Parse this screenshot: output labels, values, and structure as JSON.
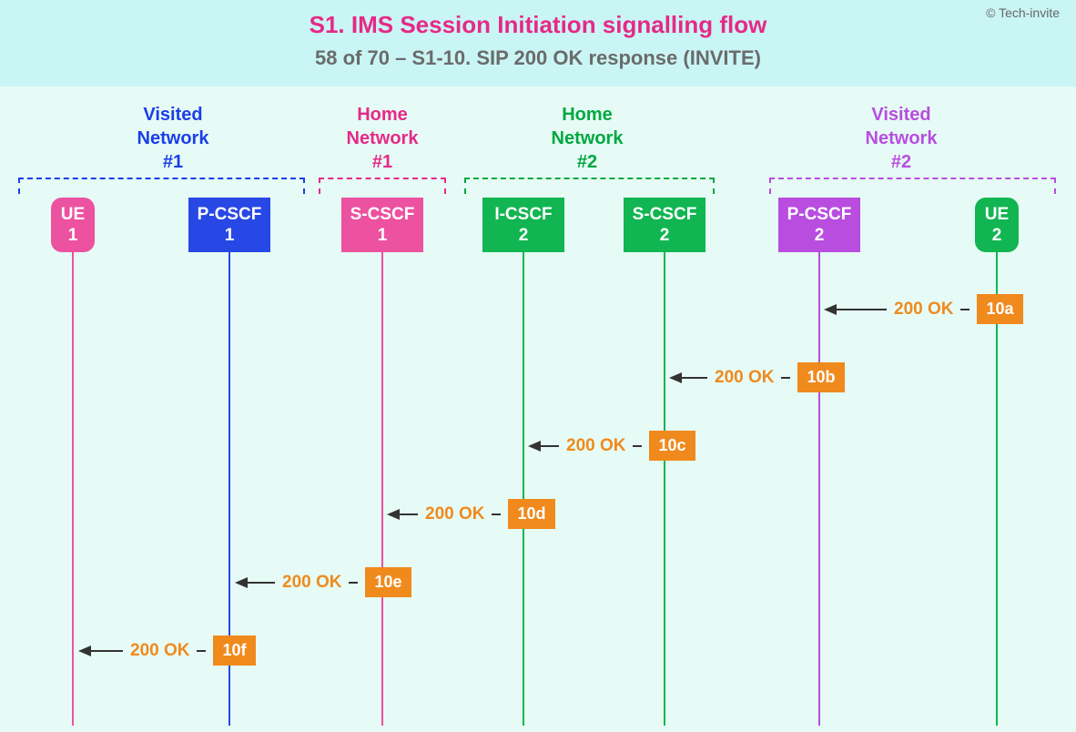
{
  "copyright": "© Tech-invite",
  "title": "S1. IMS Session Initiation signalling flow",
  "subtitle": "58 of 70 – S1-10. SIP 200 OK response (INVITE)",
  "networks": {
    "visited1": "Visited\nNetwork\n#1",
    "home1": "Home\nNetwork\n#1",
    "home2": "Home\nNetwork\n#2",
    "visited2": "Visited\nNetwork\n#2"
  },
  "nodes": {
    "ue1": "UE\n1",
    "pcscf1": "P-CSCF\n1",
    "scscf1": "S-CSCF\n1",
    "icscf2": "I-CSCF\n2",
    "scscf2": "S-CSCF\n2",
    "pcscf2": "P-CSCF\n2",
    "ue2": "UE\n2"
  },
  "msg_label": "200 OK",
  "messages": {
    "a": "10a",
    "b": "10b",
    "c": "10c",
    "d": "10d",
    "e": "10e",
    "f": "10f"
  }
}
